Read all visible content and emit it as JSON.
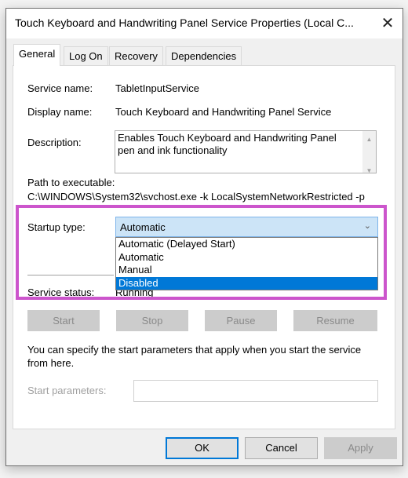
{
  "window": {
    "title": "Touch Keyboard and Handwriting Panel Service Properties (Local C...",
    "close": "✕"
  },
  "tabs": [
    "General",
    "Log On",
    "Recovery",
    "Dependencies"
  ],
  "general": {
    "service_name_label": "Service name:",
    "service_name": "TabletInputService",
    "display_name_label": "Display name:",
    "display_name": "Touch Keyboard and Handwriting Panel Service",
    "description_label": "Description:",
    "description": "Enables Touch Keyboard and Handwriting Panel pen and ink functionality",
    "path_label": "Path to executable:",
    "path": "C:\\WINDOWS\\System32\\svchost.exe -k LocalSystemNetworkRestricted -p",
    "startup_label": "Startup type:",
    "startup_value": "Automatic",
    "startup_options": [
      "Automatic (Delayed Start)",
      "Automatic",
      "Manual",
      "Disabled"
    ],
    "highlighted_option": "Disabled",
    "status_label": "Service status:",
    "status": "Running",
    "buttons": {
      "start": "Start",
      "stop": "Stop",
      "pause": "Pause",
      "resume": "Resume"
    },
    "hint": "You can specify the start parameters that apply when you start the service from here.",
    "params_label": "Start parameters:",
    "params_value": ""
  },
  "footer": {
    "ok": "OK",
    "cancel": "Cancel",
    "apply": "Apply"
  },
  "colors": {
    "highlight_box": "#cc55cc",
    "selection": "#0078d7"
  }
}
